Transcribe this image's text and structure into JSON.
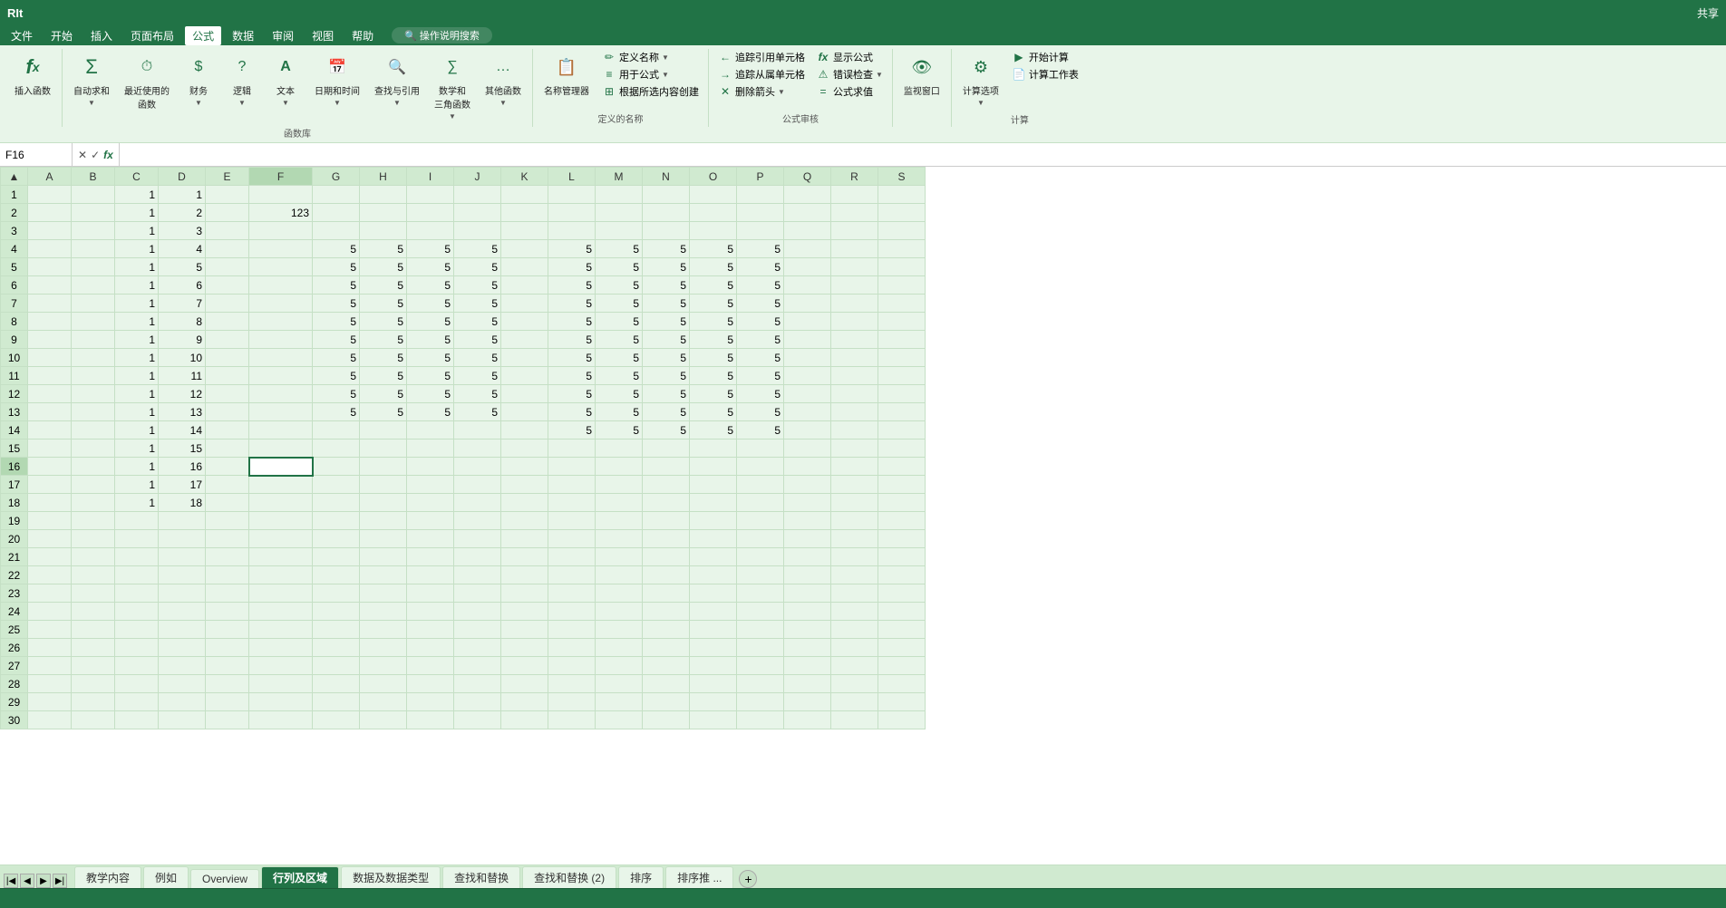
{
  "titleBar": {
    "title": "RIt",
    "shareLabel": "共享"
  },
  "menuBar": {
    "items": [
      "文件",
      "开始",
      "插入",
      "页面布局",
      "公式",
      "数据",
      "审阅",
      "视图",
      "帮助",
      "操作说明搜索"
    ]
  },
  "ribbon": {
    "groups": [
      {
        "label": "函数库",
        "items": [
          {
            "label": "插入函数",
            "icon": "fx"
          },
          {
            "label": "自动求和",
            "icon": "Σ"
          },
          {
            "label": "最近使用的函数",
            "icon": "⏱"
          },
          {
            "label": "财务",
            "icon": "$"
          },
          {
            "label": "逻辑",
            "icon": "?"
          },
          {
            "label": "文本",
            "icon": "A"
          },
          {
            "label": "日期和时间",
            "icon": "📅"
          },
          {
            "label": "查找与引用",
            "icon": "🔍"
          },
          {
            "label": "数学和三角函数",
            "icon": "∑"
          },
          {
            "label": "其他函数",
            "icon": "…"
          }
        ]
      },
      {
        "label": "定义的名称",
        "items": [
          {
            "label": "名称管理器",
            "icon": "📋"
          },
          {
            "label": "定义名称",
            "icon": "✏"
          },
          {
            "label": "用于公式",
            "icon": "≡"
          },
          {
            "label": "根据所选内容创建",
            "icon": "⊞"
          }
        ]
      },
      {
        "label": "公式审核",
        "items": [
          {
            "label": "追踪引用单元格",
            "icon": "←"
          },
          {
            "label": "追踪从属单元格",
            "icon": "→"
          },
          {
            "label": "删除箭头",
            "icon": "✕"
          },
          {
            "label": "显示公式",
            "icon": "fx"
          },
          {
            "label": "错误检查",
            "icon": "⚠"
          },
          {
            "label": "公式求值",
            "icon": "="
          }
        ]
      },
      {
        "label": "",
        "items": [
          {
            "label": "监视窗口",
            "icon": "👁"
          }
        ]
      },
      {
        "label": "计算",
        "items": [
          {
            "label": "计算选项",
            "icon": "⚙"
          },
          {
            "label": "开始计算",
            "icon": "▶"
          },
          {
            "label": "计算工作表",
            "icon": "📄"
          }
        ]
      }
    ]
  },
  "formulaBar": {
    "cellRef": "F16",
    "formula": ""
  },
  "grid": {
    "columns": [
      "A",
      "B",
      "C",
      "D",
      "E",
      "F",
      "G",
      "H",
      "I",
      "J",
      "K",
      "L",
      "M",
      "N",
      "O",
      "P",
      "Q",
      "R",
      "S"
    ],
    "selectedCell": "F16",
    "rows": [
      {
        "rowNum": 1,
        "C": "1",
        "D": "1",
        "F": "",
        "G": "",
        "H": "",
        "I": "",
        "J": "",
        "K": "",
        "L": "",
        "M": "",
        "N": "",
        "O": "",
        "P": "",
        "Q": "",
        "R": "",
        "S": ""
      },
      {
        "rowNum": 2,
        "C": "1",
        "D": "2",
        "F": "123",
        "G": "",
        "H": "",
        "I": "",
        "J": "",
        "K": "",
        "L": "",
        "M": "",
        "N": "",
        "O": "",
        "P": "",
        "Q": "",
        "R": "",
        "S": ""
      },
      {
        "rowNum": 3,
        "C": "1",
        "D": "3",
        "F": "",
        "G": "",
        "H": "",
        "I": "",
        "J": "",
        "K": "",
        "L": "",
        "M": "",
        "N": "",
        "O": "",
        "P": "",
        "Q": "",
        "R": "",
        "S": ""
      },
      {
        "rowNum": 4,
        "C": "1",
        "D": "4",
        "F": "",
        "G": "5",
        "H": "5",
        "I": "5",
        "J": "5",
        "K": "",
        "L": "5",
        "M": "5",
        "N": "5",
        "O": "5",
        "P": "5",
        "Q": "",
        "R": "",
        "S": ""
      },
      {
        "rowNum": 5,
        "C": "1",
        "D": "5",
        "F": "",
        "G": "5",
        "H": "5",
        "I": "5",
        "J": "5",
        "K": "",
        "L": "5",
        "M": "5",
        "N": "5",
        "O": "5",
        "P": "5",
        "Q": "",
        "R": "",
        "S": ""
      },
      {
        "rowNum": 6,
        "C": "1",
        "D": "6",
        "F": "",
        "G": "5",
        "H": "5",
        "I": "5",
        "J": "5",
        "K": "",
        "L": "5",
        "M": "5",
        "N": "5",
        "O": "5",
        "P": "5",
        "Q": "",
        "R": "",
        "S": ""
      },
      {
        "rowNum": 7,
        "C": "1",
        "D": "7",
        "F": "",
        "G": "5",
        "H": "5",
        "I": "5",
        "J": "5",
        "K": "",
        "L": "5",
        "M": "5",
        "N": "5",
        "O": "5",
        "P": "5",
        "Q": "",
        "R": "",
        "S": ""
      },
      {
        "rowNum": 8,
        "C": "1",
        "D": "8",
        "F": "",
        "G": "5",
        "H": "5",
        "I": "5",
        "J": "5",
        "K": "",
        "L": "5",
        "M": "5",
        "N": "5",
        "O": "5",
        "P": "5",
        "Q": "",
        "R": "",
        "S": ""
      },
      {
        "rowNum": 9,
        "C": "1",
        "D": "9",
        "F": "",
        "G": "5",
        "H": "5",
        "I": "5",
        "J": "5",
        "K": "",
        "L": "5",
        "M": "5",
        "N": "5",
        "O": "5",
        "P": "5",
        "Q": "",
        "R": "",
        "S": ""
      },
      {
        "rowNum": 10,
        "C": "1",
        "D": "10",
        "F": "",
        "G": "5",
        "H": "5",
        "I": "5",
        "J": "5",
        "K": "",
        "L": "5",
        "M": "5",
        "N": "5",
        "O": "5",
        "P": "5",
        "Q": "",
        "R": "",
        "S": ""
      },
      {
        "rowNum": 11,
        "C": "1",
        "D": "11",
        "F": "",
        "G": "5",
        "H": "5",
        "I": "5",
        "J": "5",
        "K": "",
        "L": "5",
        "M": "5",
        "N": "5",
        "O": "5",
        "P": "5",
        "Q": "",
        "R": "",
        "S": ""
      },
      {
        "rowNum": 12,
        "C": "1",
        "D": "12",
        "F": "",
        "G": "5",
        "H": "5",
        "I": "5",
        "J": "5",
        "K": "",
        "L": "5",
        "M": "5",
        "N": "5",
        "O": "5",
        "P": "5",
        "Q": "",
        "R": "",
        "S": ""
      },
      {
        "rowNum": 13,
        "C": "1",
        "D": "13",
        "F": "",
        "G": "5",
        "H": "5",
        "I": "5",
        "J": "5",
        "K": "",
        "L": "5",
        "M": "5",
        "N": "5",
        "O": "5",
        "P": "5",
        "Q": "",
        "R": "",
        "S": ""
      },
      {
        "rowNum": 14,
        "C": "1",
        "D": "14",
        "F": "",
        "G": "",
        "H": "",
        "I": "",
        "J": "",
        "K": "",
        "L": "5",
        "M": "5",
        "N": "5",
        "O": "5",
        "P": "5",
        "Q": "",
        "R": "",
        "S": ""
      },
      {
        "rowNum": 15,
        "C": "1",
        "D": "15",
        "F": "",
        "G": "",
        "H": "",
        "I": "",
        "J": "",
        "K": "",
        "L": "",
        "M": "",
        "N": "",
        "O": "",
        "P": "",
        "Q": "",
        "R": "",
        "S": ""
      },
      {
        "rowNum": 16,
        "C": "1",
        "D": "16",
        "F": "",
        "G": "",
        "H": "",
        "I": "",
        "J": "",
        "K": "",
        "L": "",
        "M": "",
        "N": "",
        "O": "",
        "P": "",
        "Q": "",
        "R": "",
        "S": ""
      },
      {
        "rowNum": 17,
        "C": "1",
        "D": "17",
        "F": "",
        "G": "",
        "H": "",
        "I": "",
        "J": "",
        "K": "",
        "L": "",
        "M": "",
        "N": "",
        "O": "",
        "P": "",
        "Q": "",
        "R": "",
        "S": ""
      },
      {
        "rowNum": 18,
        "C": "1",
        "D": "18",
        "F": "",
        "G": "",
        "H": "",
        "I": "",
        "J": "",
        "K": "",
        "L": "",
        "M": "",
        "N": "",
        "O": "",
        "P": "",
        "Q": "",
        "R": "",
        "S": ""
      },
      {
        "rowNum": 19
      },
      {
        "rowNum": 20
      },
      {
        "rowNum": 21
      },
      {
        "rowNum": 22
      },
      {
        "rowNum": 23
      },
      {
        "rowNum": 24
      },
      {
        "rowNum": 25
      },
      {
        "rowNum": 26
      },
      {
        "rowNum": 27
      },
      {
        "rowNum": 28
      },
      {
        "rowNum": 29
      },
      {
        "rowNum": 30
      }
    ]
  },
  "sheetTabs": {
    "tabs": [
      "教学内容",
      "例如",
      "Overview",
      "行列及区域",
      "数据及数据类型",
      "查找和替换",
      "查找和替换 (2)",
      "排序",
      "排序推 ..."
    ],
    "activeTab": "行列及区域",
    "addLabel": "+"
  },
  "statusBar": {
    "items": [
      "",
      ""
    ]
  }
}
